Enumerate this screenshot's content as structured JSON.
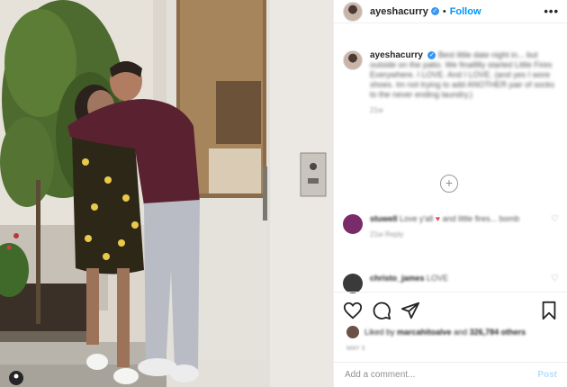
{
  "post": {
    "username": "ayeshacurry",
    "follow_label": "Follow",
    "separator": "•",
    "verified_glyph": "✓",
    "more_glyph": "•••"
  },
  "caption": {
    "username": "ayeshacurry",
    "text": "Best little date night in... but outside on the patio. We finallllly started Little Fires Everywhere. I LOVE. And I LOVE. (and yes I wore shoes. Im not trying to add ANOTHER pair of socks to the never ending laundry.)",
    "time": "21w"
  },
  "load_more_glyph": "+",
  "comments": [
    {
      "username": "stuwell",
      "text": "Love y'all ",
      "heart": "♥",
      "text_after": "and little fires... bomb",
      "meta": "21w    Reply",
      "avatar_color": "#7a2b6a"
    },
    {
      "username": "christo_james",
      "text": "LOVE",
      "meta": "",
      "avatar_color": "#3a3a3a"
    }
  ],
  "like_icon": "heart-outline-icon",
  "likes": {
    "prefix": "Liked by ",
    "user": "marcahitoalve",
    "middle": " and ",
    "count": "326,784 others"
  },
  "date": "MAY 3",
  "add_comment": {
    "placeholder": "Add a comment...",
    "post_label": "Post"
  },
  "colors": {
    "follow_blue": "#0095f6",
    "post_disabled": "#b2dffc",
    "heart_red": "#ed4956"
  }
}
